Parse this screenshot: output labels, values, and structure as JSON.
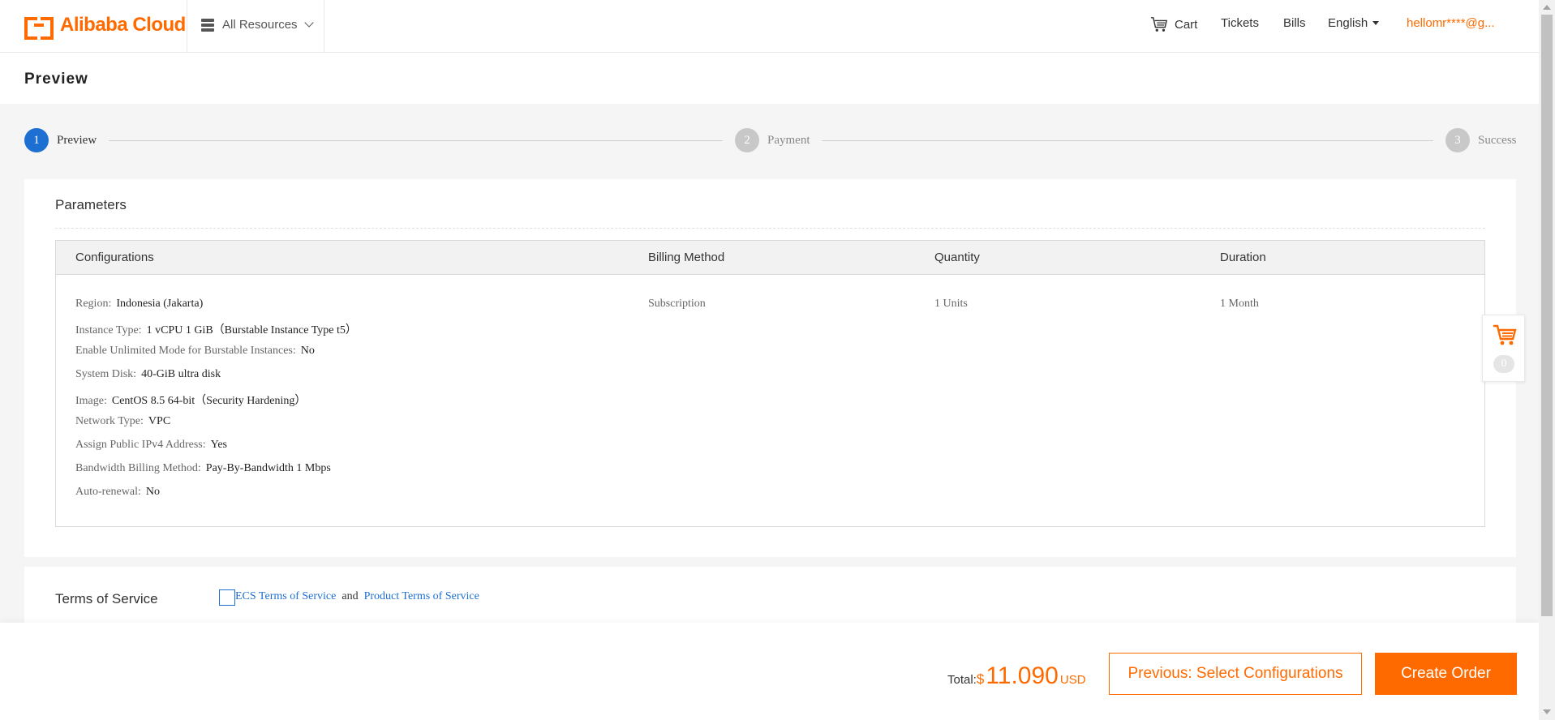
{
  "header": {
    "brand": "Alibaba Cloud",
    "resources": "All Resources",
    "cart": "Cart",
    "tickets": "Tickets",
    "bills": "Bills",
    "language": "English",
    "user": "hellomr****@g..."
  },
  "page": {
    "title": "Preview"
  },
  "steps": [
    {
      "number": "1",
      "label": "Preview",
      "state": "active"
    },
    {
      "number": "2",
      "label": "Payment",
      "state": "pending"
    },
    {
      "number": "3",
      "label": "Success",
      "state": "pending"
    }
  ],
  "parameters": {
    "title": "Parameters",
    "columns": {
      "configurations": "Configurations",
      "billing_method": "Billing Method",
      "quantity": "Quantity",
      "duration": "Duration"
    },
    "configs": [
      {
        "key": "Region:",
        "value": "Indonesia (Jakarta)"
      },
      {
        "key": "Instance Type:",
        "value": "1 vCPU 1 GiB（Burstable Instance Type t5）"
      },
      {
        "key": "Enable Unlimited Mode for Burstable Instances:",
        "value": "No"
      },
      {
        "key": "System Disk:",
        "value": "40-GiB ultra disk"
      },
      {
        "key": "Image:",
        "value": "CentOS  8.5 64-bit（Security Hardening）"
      },
      {
        "key": "Network Type:",
        "value": "VPC"
      },
      {
        "key": "Assign Public IPv4 Address:",
        "value": "Yes"
      },
      {
        "key": "Bandwidth Billing Method:",
        "value": "Pay-By-Bandwidth 1 Mbps"
      },
      {
        "key": "Auto-renewal:",
        "value": "No"
      }
    ],
    "billing_method": "Subscription",
    "quantity": "1 Units",
    "duration": "1 Month"
  },
  "float_cart": {
    "count": "0"
  },
  "terms": {
    "title": "Terms of Service",
    "ecs_link": "ECS Terms of Service",
    "and": "and",
    "product_link": "Product Terms of Service",
    "checked": false
  },
  "footer": {
    "total_label": "Total:",
    "currency_symbol": "$",
    "amount": "11.090",
    "unit": "USD",
    "prev_button": "Previous: Select Configurations",
    "create_button": "Create Order"
  },
  "colors": {
    "accent": "#ff6a00",
    "link": "#1d6fd2",
    "step_active": "#1d6fd2",
    "step_pending": "#c8c8c8"
  }
}
